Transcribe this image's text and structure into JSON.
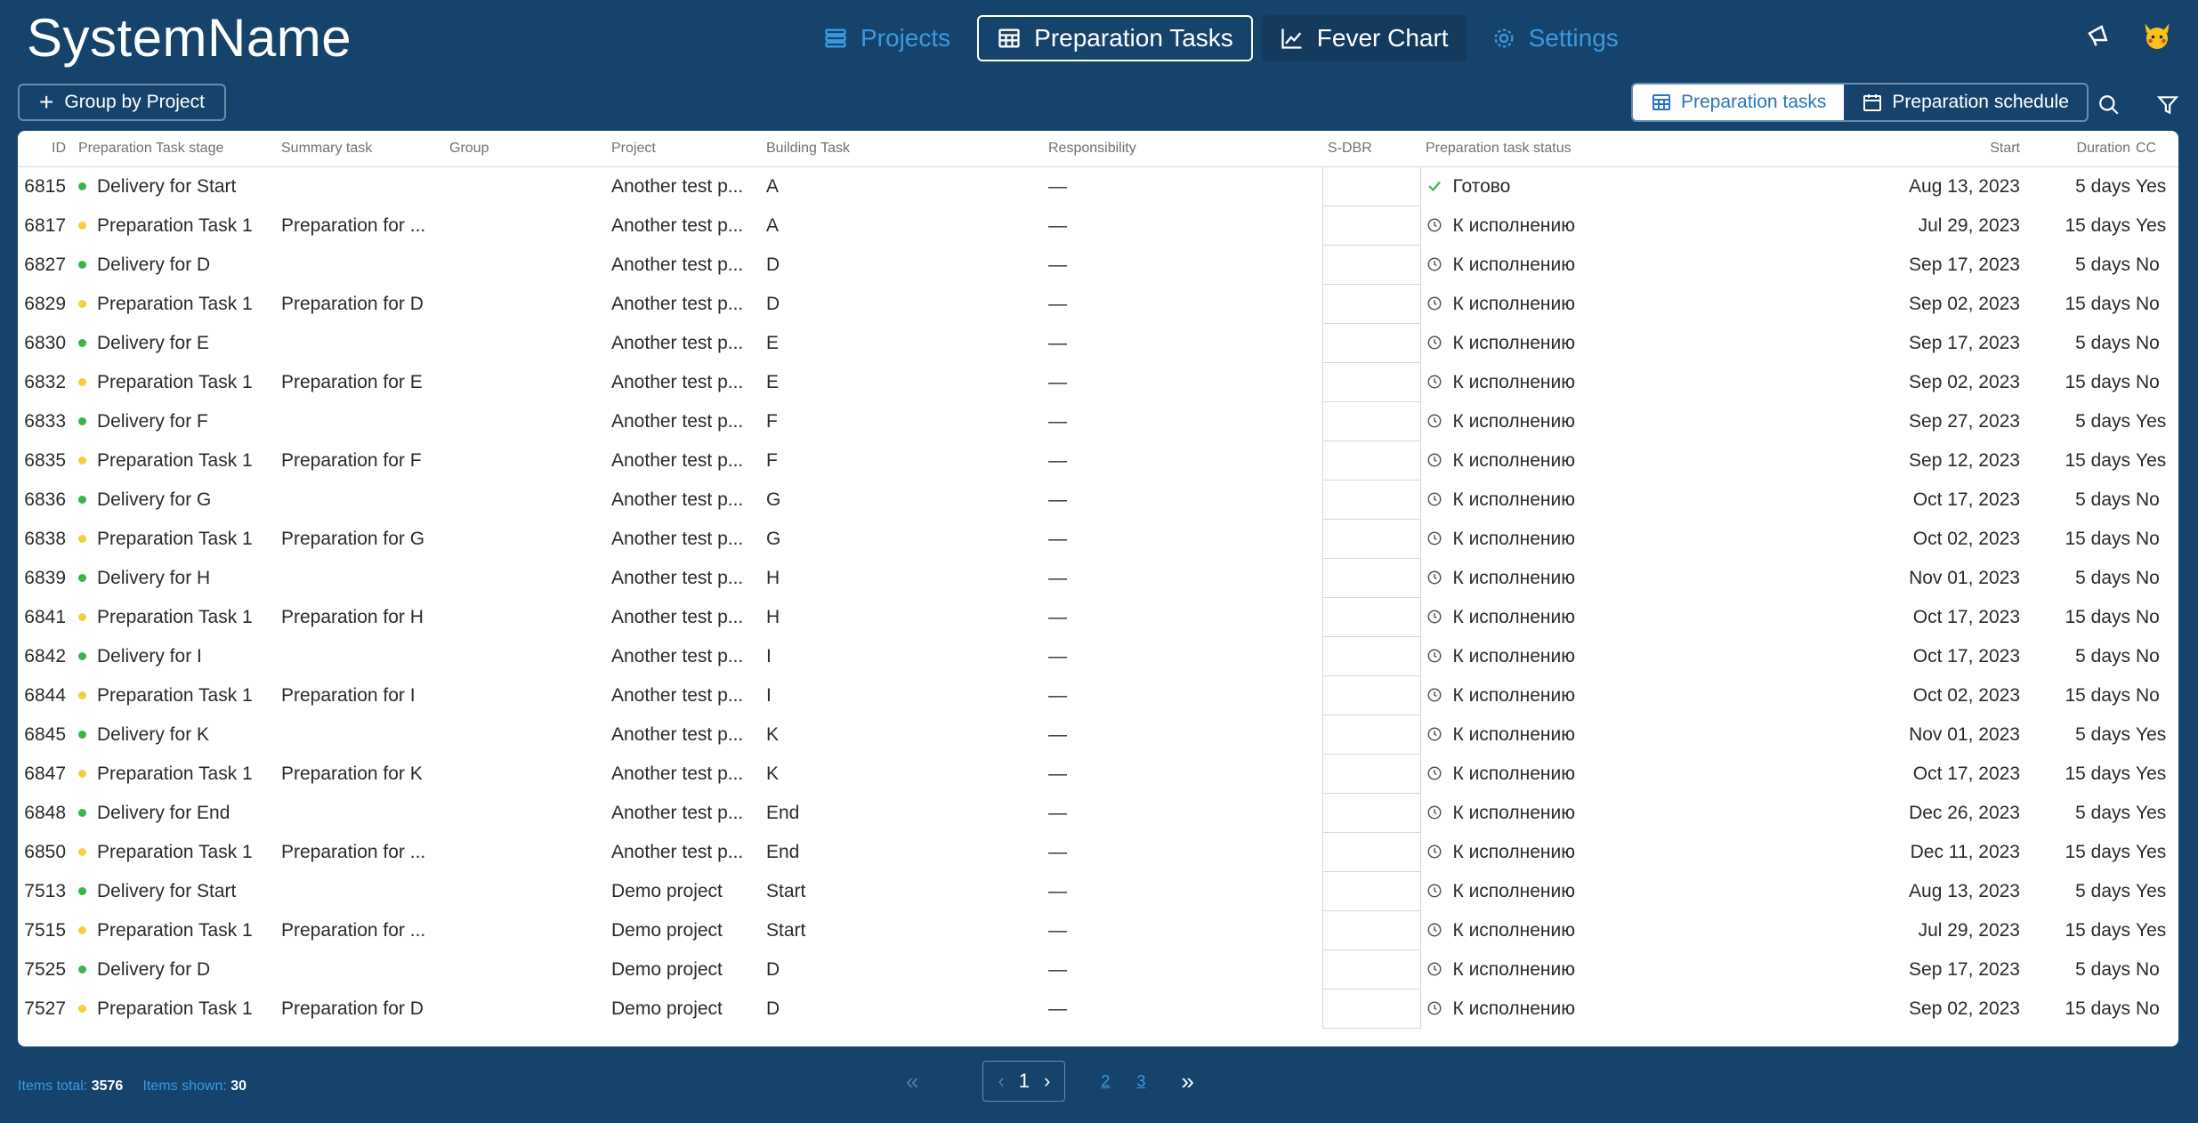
{
  "brand": "SystemName",
  "nav": {
    "projects": "Projects",
    "preparation_tasks": "Preparation Tasks",
    "fever_chart": "Fever Chart",
    "settings": "Settings"
  },
  "toolbar": {
    "group_by": "Group by Project",
    "view_tasks": "Preparation tasks",
    "view_schedule": "Preparation schedule"
  },
  "columns": {
    "id": "ID",
    "stage": "Preparation Task stage",
    "summary": "Summary task",
    "group": "Group",
    "project": "Project",
    "building": "Building Task",
    "responsibility": "Responsibility",
    "sdbr": "S-DBR",
    "status": "Preparation task status",
    "start": "Start",
    "duration": "Duration",
    "cc": "CC"
  },
  "rows": [
    {
      "id": "6815",
      "stage": "Delivery for Start",
      "dot": "green",
      "summary": "",
      "group": "",
      "project": "Another test p...",
      "building": "A",
      "resp": "—",
      "status": "Готово",
      "done": true,
      "start": "Aug 13, 2023",
      "duration": "5 days",
      "cc": "Yes"
    },
    {
      "id": "6817",
      "stage": "Preparation Task 1",
      "dot": "yellow",
      "summary": "Preparation for ...",
      "group": "",
      "project": "Another test p...",
      "building": "A",
      "resp": "—",
      "status": "К исполнению",
      "done": false,
      "start": "Jul 29, 2023",
      "duration": "15 days",
      "cc": "Yes"
    },
    {
      "id": "6827",
      "stage": "Delivery for D",
      "dot": "green",
      "summary": "",
      "group": "",
      "project": "Another test p...",
      "building": "D",
      "resp": "—",
      "status": "К исполнению",
      "done": false,
      "start": "Sep 17, 2023",
      "duration": "5 days",
      "cc": "No"
    },
    {
      "id": "6829",
      "stage": "Preparation Task 1",
      "dot": "yellow",
      "summary": "Preparation for D",
      "group": "",
      "project": "Another test p...",
      "building": "D",
      "resp": "—",
      "status": "К исполнению",
      "done": false,
      "start": "Sep 02, 2023",
      "duration": "15 days",
      "cc": "No"
    },
    {
      "id": "6830",
      "stage": "Delivery for E",
      "dot": "green",
      "summary": "",
      "group": "",
      "project": "Another test p...",
      "building": "E",
      "resp": "—",
      "status": "К исполнению",
      "done": false,
      "start": "Sep 17, 2023",
      "duration": "5 days",
      "cc": "No"
    },
    {
      "id": "6832",
      "stage": "Preparation Task 1",
      "dot": "yellow",
      "summary": "Preparation for E",
      "group": "",
      "project": "Another test p...",
      "building": "E",
      "resp": "—",
      "status": "К исполнению",
      "done": false,
      "start": "Sep 02, 2023",
      "duration": "15 days",
      "cc": "No"
    },
    {
      "id": "6833",
      "stage": "Delivery for F",
      "dot": "green",
      "summary": "",
      "group": "",
      "project": "Another test p...",
      "building": "F",
      "resp": "—",
      "status": "К исполнению",
      "done": false,
      "start": "Sep 27, 2023",
      "duration": "5 days",
      "cc": "Yes"
    },
    {
      "id": "6835",
      "stage": "Preparation Task 1",
      "dot": "yellow",
      "summary": "Preparation for F",
      "group": "",
      "project": "Another test p...",
      "building": "F",
      "resp": "—",
      "status": "К исполнению",
      "done": false,
      "start": "Sep 12, 2023",
      "duration": "15 days",
      "cc": "Yes"
    },
    {
      "id": "6836",
      "stage": "Delivery for G",
      "dot": "green",
      "summary": "",
      "group": "",
      "project": "Another test p...",
      "building": "G",
      "resp": "—",
      "status": "К исполнению",
      "done": false,
      "start": "Oct 17, 2023",
      "duration": "5 days",
      "cc": "No"
    },
    {
      "id": "6838",
      "stage": "Preparation Task 1",
      "dot": "yellow",
      "summary": "Preparation for G",
      "group": "",
      "project": "Another test p...",
      "building": "G",
      "resp": "—",
      "status": "К исполнению",
      "done": false,
      "start": "Oct 02, 2023",
      "duration": "15 days",
      "cc": "No"
    },
    {
      "id": "6839",
      "stage": "Delivery for H",
      "dot": "green",
      "summary": "",
      "group": "",
      "project": "Another test p...",
      "building": "H",
      "resp": "—",
      "status": "К исполнению",
      "done": false,
      "start": "Nov 01, 2023",
      "duration": "5 days",
      "cc": "No"
    },
    {
      "id": "6841",
      "stage": "Preparation Task 1",
      "dot": "yellow",
      "summary": "Preparation for H",
      "group": "",
      "project": "Another test p...",
      "building": "H",
      "resp": "—",
      "status": "К исполнению",
      "done": false,
      "start": "Oct 17, 2023",
      "duration": "15 days",
      "cc": "No"
    },
    {
      "id": "6842",
      "stage": "Delivery for I",
      "dot": "green",
      "summary": "",
      "group": "",
      "project": "Another test p...",
      "building": "I",
      "resp": "—",
      "status": "К исполнению",
      "done": false,
      "start": "Oct 17, 2023",
      "duration": "5 days",
      "cc": "No"
    },
    {
      "id": "6844",
      "stage": "Preparation Task 1",
      "dot": "yellow",
      "summary": "Preparation for I",
      "group": "",
      "project": "Another test p...",
      "building": "I",
      "resp": "—",
      "status": "К исполнению",
      "done": false,
      "start": "Oct 02, 2023",
      "duration": "15 days",
      "cc": "No"
    },
    {
      "id": "6845",
      "stage": "Delivery for K",
      "dot": "green",
      "summary": "",
      "group": "",
      "project": "Another test p...",
      "building": "K",
      "resp": "—",
      "status": "К исполнению",
      "done": false,
      "start": "Nov 01, 2023",
      "duration": "5 days",
      "cc": "Yes"
    },
    {
      "id": "6847",
      "stage": "Preparation Task 1",
      "dot": "yellow",
      "summary": "Preparation for K",
      "group": "",
      "project": "Another test p...",
      "building": "K",
      "resp": "—",
      "status": "К исполнению",
      "done": false,
      "start": "Oct 17, 2023",
      "duration": "15 days",
      "cc": "Yes"
    },
    {
      "id": "6848",
      "stage": "Delivery for End",
      "dot": "green",
      "summary": "",
      "group": "",
      "project": "Another test p...",
      "building": "End",
      "resp": "—",
      "status": "К исполнению",
      "done": false,
      "start": "Dec 26, 2023",
      "duration": "5 days",
      "cc": "Yes"
    },
    {
      "id": "6850",
      "stage": "Preparation Task 1",
      "dot": "yellow",
      "summary": "Preparation for ...",
      "group": "",
      "project": "Another test p...",
      "building": "End",
      "resp": "—",
      "status": "К исполнению",
      "done": false,
      "start": "Dec 11, 2023",
      "duration": "15 days",
      "cc": "Yes"
    },
    {
      "id": "7513",
      "stage": "Delivery for Start",
      "dot": "green",
      "summary": "",
      "group": "",
      "project": "Demo project",
      "building": "Start",
      "resp": "—",
      "status": "К исполнению",
      "done": false,
      "start": "Aug 13, 2023",
      "duration": "5 days",
      "cc": "Yes"
    },
    {
      "id": "7515",
      "stage": "Preparation Task 1",
      "dot": "yellow",
      "summary": "Preparation for ...",
      "group": "",
      "project": "Demo project",
      "building": "Start",
      "resp": "—",
      "status": "К исполнению",
      "done": false,
      "start": "Jul 29, 2023",
      "duration": "15 days",
      "cc": "Yes"
    },
    {
      "id": "7525",
      "stage": "Delivery for D",
      "dot": "green",
      "summary": "",
      "group": "",
      "project": "Demo project",
      "building": "D",
      "resp": "—",
      "status": "К исполнению",
      "done": false,
      "start": "Sep 17, 2023",
      "duration": "5 days",
      "cc": "No"
    },
    {
      "id": "7527",
      "stage": "Preparation Task 1",
      "dot": "yellow",
      "summary": "Preparation for D",
      "group": "",
      "project": "Demo project",
      "building": "D",
      "resp": "—",
      "status": "К исполнению",
      "done": false,
      "start": "Sep 02, 2023",
      "duration": "15 days",
      "cc": "No"
    }
  ],
  "footer": {
    "total_label": "Items total:",
    "total_value": "3576",
    "shown_label": "Items shown:",
    "shown_value": "30"
  },
  "pagination": {
    "current": "1",
    "page2": "2",
    "page3": "3"
  },
  "colors": {
    "background": "#16436b",
    "accent": "#3b98e0",
    "dot_green": "#3cb44b",
    "dot_yellow": "#f3d13d"
  }
}
